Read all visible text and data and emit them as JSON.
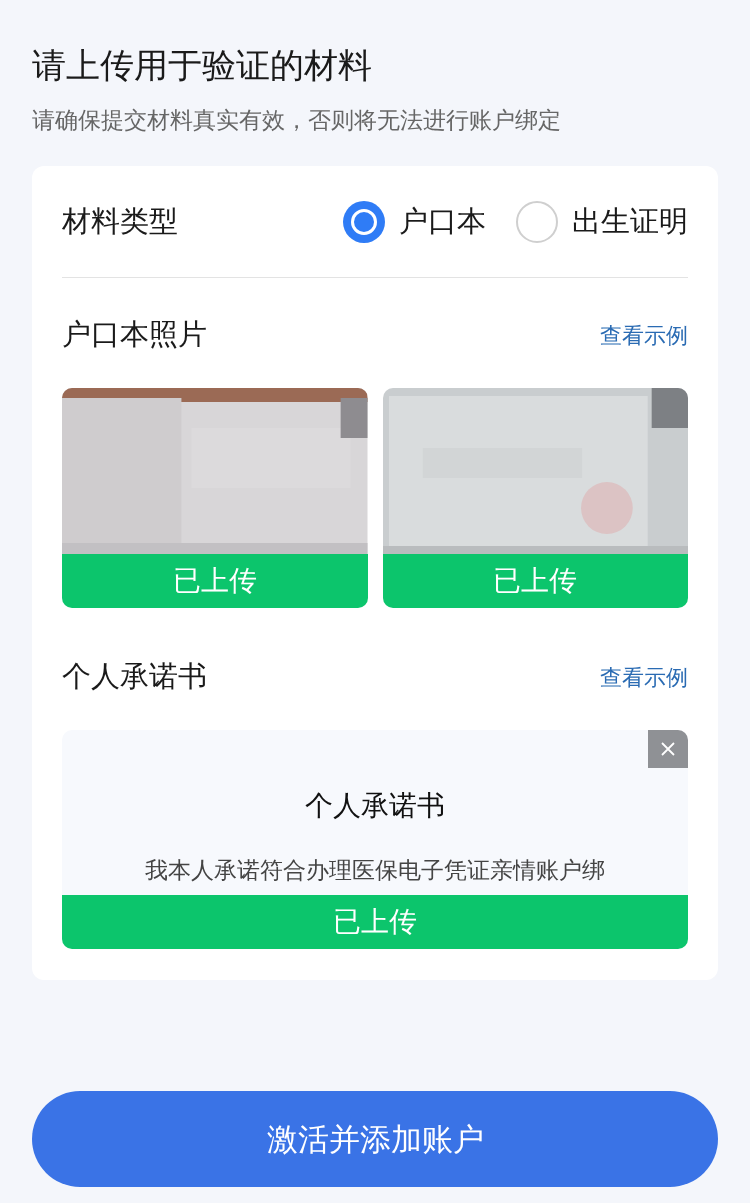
{
  "title": "请上传用于验证的材料",
  "subtitle": "请确保提交材料真实有效，否则将无法进行账户绑定",
  "material_type": {
    "label": "材料类型",
    "options": [
      {
        "label": "户口本",
        "selected": true
      },
      {
        "label": "出生证明",
        "selected": false
      }
    ]
  },
  "sections": [
    {
      "title": "户口本照片",
      "example_link": "查看示例",
      "items": [
        {
          "kind": "picture",
          "status": "已上传"
        },
        {
          "kind": "picture",
          "status": "已上传"
        }
      ]
    },
    {
      "title": "个人承诺书",
      "example_link": "查看示例",
      "items": [
        {
          "kind": "document",
          "doc_title": "个人承诺书",
          "doc_text": "我本人承诺符合办理医保电子凭证亲情账户绑",
          "removable": true,
          "status": "已上传"
        }
      ]
    }
  ],
  "submit_button": "激活并添加账户"
}
